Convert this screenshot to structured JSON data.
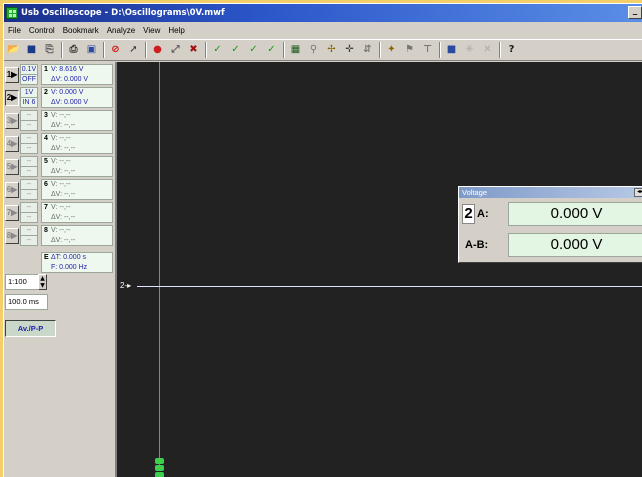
{
  "window": {
    "title": "Usb Oscilloscope - D:\\Oscillograms\\0V.mwf",
    "min_button": "_"
  },
  "menu": [
    "File",
    "Control",
    "Bookmark",
    "Analyze",
    "View",
    "Help"
  ],
  "toolbar": {
    "icons": [
      {
        "name": "open-icon",
        "glyph": "📂",
        "color": "#c08a10"
      },
      {
        "name": "save-icon",
        "glyph": "■",
        "color": "#1a3a8a"
      },
      {
        "name": "export-icon",
        "glyph": "⎘",
        "color": "#555555"
      },
      {
        "sep": true
      },
      {
        "name": "print-icon",
        "glyph": "⎙",
        "color": "#333333"
      },
      {
        "name": "print-setup-icon",
        "glyph": "▣",
        "color": "#2a4aa0"
      },
      {
        "sep": true
      },
      {
        "name": "stop-icon",
        "glyph": "⊘",
        "color": "#d01010"
      },
      {
        "name": "run-icon",
        "glyph": "➚",
        "color": "#333333"
      },
      {
        "sep": true
      },
      {
        "name": "record-icon",
        "glyph": "●",
        "color": "#cc2020"
      },
      {
        "name": "cursor-tool-icon",
        "glyph": "⤢",
        "color": "#555555"
      },
      {
        "name": "tools-icon",
        "glyph": "✖",
        "color": "#a01010"
      },
      {
        "sep": true
      },
      {
        "name": "check-icon",
        "glyph": "✓",
        "color": "#1a9a1a"
      },
      {
        "name": "check-a-icon",
        "glyph": "✓",
        "color": "#1a9a1a"
      },
      {
        "name": "check-double-icon",
        "glyph": "✓",
        "color": "#1a9a1a"
      },
      {
        "name": "check-b-icon",
        "glyph": "✓",
        "color": "#1a9a1a"
      },
      {
        "sep": true
      },
      {
        "name": "spectrum-icon",
        "glyph": "▦",
        "color": "#1a5a1a"
      },
      {
        "name": "zoom-icon",
        "glyph": "⚲",
        "color": "#777777"
      },
      {
        "name": "measure-icon",
        "glyph": "✢",
        "color": "#886600"
      },
      {
        "name": "cursor-cross-icon",
        "glyph": "✛",
        "color": "#444444"
      },
      {
        "name": "cursor-align-icon",
        "glyph": "⇵",
        "color": "#777777"
      },
      {
        "sep": true
      },
      {
        "name": "bookmark-icon",
        "glyph": "✦",
        "color": "#886600"
      },
      {
        "name": "marker-icon",
        "glyph": "⚑",
        "color": "#777777"
      },
      {
        "name": "trigger-icon",
        "glyph": "⊤",
        "color": "#777777"
      },
      {
        "sep": true
      },
      {
        "name": "screen-icon",
        "glyph": "■",
        "color": "#2a4aa0"
      },
      {
        "name": "clear-icon",
        "glyph": "✳",
        "color": "#aaaaaa"
      },
      {
        "name": "delete-icon",
        "glyph": "✕",
        "color": "#aaaaaa"
      },
      {
        "sep": true
      },
      {
        "name": "help-icon",
        "glyph": "?",
        "color": "#1a1a1a"
      }
    ]
  },
  "channels": [
    {
      "btn": "1▶",
      "set_top": "0.1V",
      "set_bot": "OFF",
      "num": "1",
      "r1": "V: 8.616 V",
      "r2": "ΔV: 0.000 V",
      "enabled": true,
      "active": false
    },
    {
      "btn": "2▶",
      "set_top": "1V",
      "set_bot": "IN 6",
      "num": "2",
      "r1": "V: 0.000 V",
      "r2": "ΔV: 0.000 V",
      "enabled": true,
      "active": true
    },
    {
      "btn": "3▶",
      "set_top": "--",
      "set_bot": "--",
      "num": "3",
      "r1": "V:   --,--",
      "r2": "ΔV:  --,--",
      "enabled": false,
      "active": false
    },
    {
      "btn": "4▶",
      "set_top": "--",
      "set_bot": "--",
      "num": "4",
      "r1": "V:   --,--",
      "r2": "ΔV:  --,--",
      "enabled": false,
      "active": false
    },
    {
      "btn": "5▶",
      "set_top": "--",
      "set_bot": "--",
      "num": "5",
      "r1": "V:   --,--",
      "r2": "ΔV:  --,--",
      "enabled": false,
      "active": false
    },
    {
      "btn": "6▶",
      "set_top": "--",
      "set_bot": "--",
      "num": "6",
      "r1": "V:   --,--",
      "r2": "ΔV:  --,--",
      "enabled": false,
      "active": false
    },
    {
      "btn": "7▶",
      "set_top": "--",
      "set_bot": "--",
      "num": "7",
      "r1": "V:   --,--",
      "r2": "ΔV:  --,--",
      "enabled": false,
      "active": false
    },
    {
      "btn": "8▶",
      "set_top": "--",
      "set_bot": "--",
      "num": "8",
      "r1": "V:   --,--",
      "r2": "ΔV:  --,--",
      "enabled": false,
      "active": false
    }
  ],
  "timebase": {
    "ratio": "1:100",
    "timediv": "100.0 ms",
    "av_button": "Av./P-P",
    "et_label": "E",
    "dt": "ΔT: 0.000 s",
    "freq": "F: 0.000 Hz"
  },
  "scope": {
    "trace_marker": "2-▸",
    "trace_color": "#d8e8ff",
    "cursor_color": "#2fbf3f",
    "background": "#222222"
  },
  "voltage_window": {
    "title": "Voltage",
    "close_glyph": "◂▸",
    "channel": "2",
    "row_a_label": "A:",
    "row_a_value": "0.000 V",
    "row_ab_label": "A-B:",
    "row_ab_value": "0.000 V"
  }
}
